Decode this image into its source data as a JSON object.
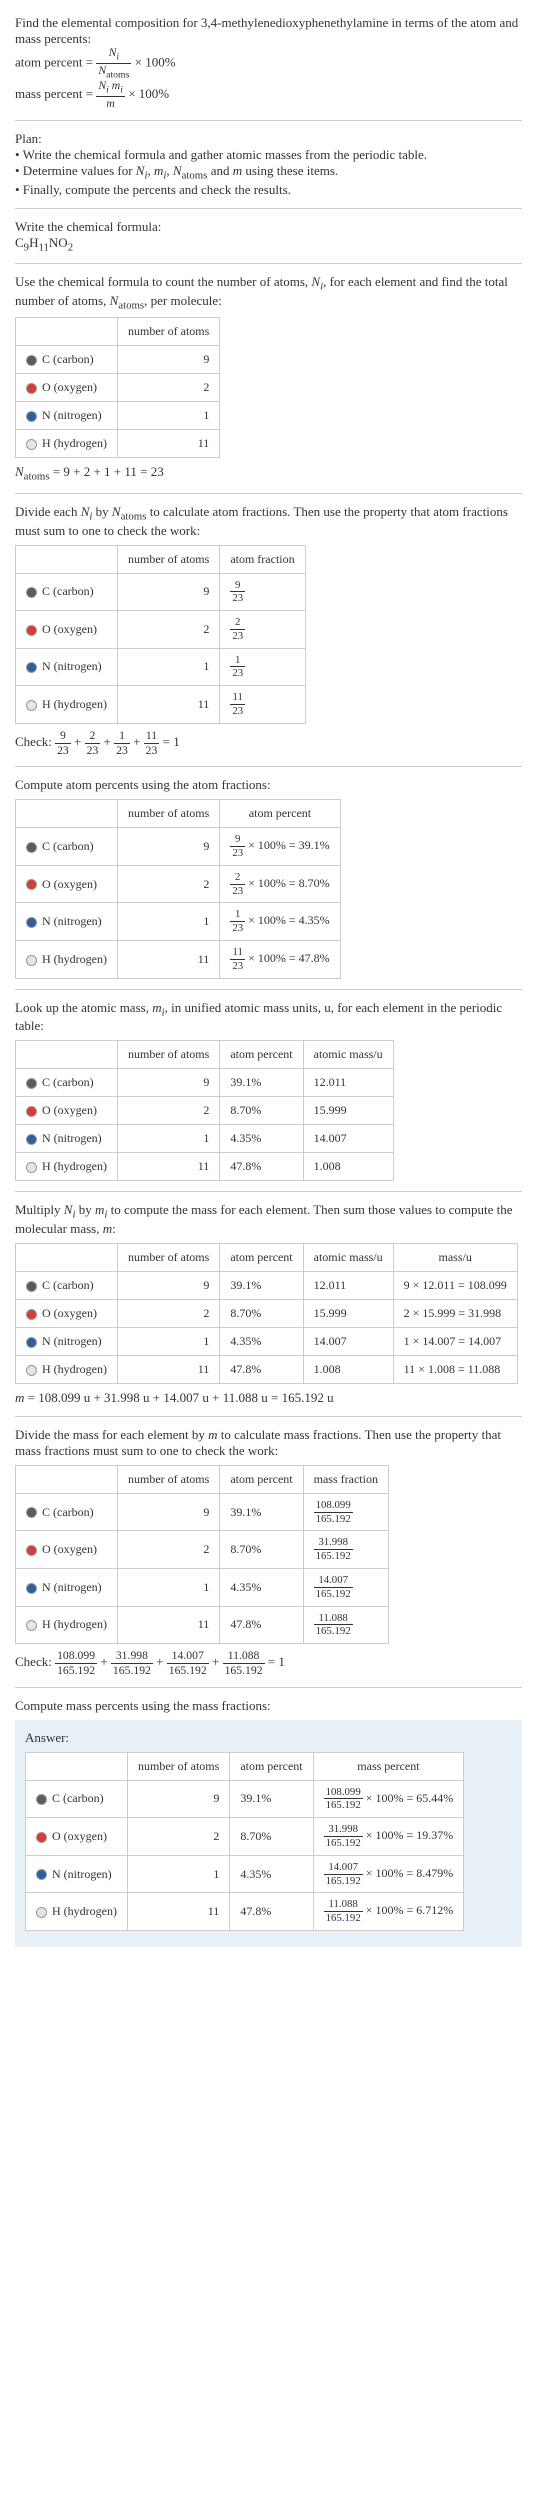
{
  "intro": {
    "title": "Find the elemental composition for 3,4-methylenedioxyphenethylamine in terms of the atom and mass percents:",
    "atom_percent_label": "atom percent =",
    "atom_percent_num": "N_i",
    "atom_percent_den": "N_atoms",
    "times100": "× 100%",
    "mass_percent_label": "mass percent =",
    "mass_percent_num": "N_i m_i",
    "mass_percent_den": "m"
  },
  "plan": {
    "heading": "Plan:",
    "b1": "• Write the chemical formula and gather atomic masses from the periodic table.",
    "b2_a": "• Determine values for ",
    "b2_b": " using these items.",
    "b3": "• Finally, compute the percents and check the results."
  },
  "plan_vars": {
    "ni": "N_i",
    "mi": "m_i",
    "na": "N_atoms",
    "m": "m",
    "and": " and "
  },
  "step_formula": {
    "label": "Write the chemical formula:",
    "formula": "C9H11NO2"
  },
  "step_count": {
    "label_a": "Use the chemical formula to count the number of atoms, ",
    "label_b": ", for each element and find the total number of atoms, ",
    "label_c": ", per molecule:",
    "h_numatoms": "number of atoms",
    "elements": [
      {
        "color": "#5b5b5b",
        "name": "C (carbon)",
        "n": "9"
      },
      {
        "color": "#d93a3a",
        "name": "O (oxygen)",
        "n": "2"
      },
      {
        "color": "#2b5fa0",
        "name": "N (nitrogen)",
        "n": "1"
      },
      {
        "color": "#e5e5e5",
        "name": "H (hydrogen)",
        "n": "11"
      }
    ],
    "total_label": "N_atoms",
    "total_eq": " = 9 + 2 + 1 + 11 = 23"
  },
  "step_atom_frac": {
    "label_a": "Divide each ",
    "label_b": " by ",
    "label_c": " to calculate atom fractions. Then use the property that atom fractions must sum to one to check the work:",
    "h_numatoms": "number of atoms",
    "h_frac": "atom fraction",
    "rows": [
      {
        "color": "#5b5b5b",
        "name": "C (carbon)",
        "n": "9",
        "num": "9",
        "den": "23"
      },
      {
        "color": "#d93a3a",
        "name": "O (oxygen)",
        "n": "2",
        "num": "2",
        "den": "23"
      },
      {
        "color": "#2b5fa0",
        "name": "N (nitrogen)",
        "n": "1",
        "num": "1",
        "den": "23"
      },
      {
        "color": "#e5e5e5",
        "name": "H (hydrogen)",
        "n": "11",
        "num": "11",
        "den": "23"
      }
    ],
    "check_label": "Check: ",
    "check_eq": " = 1"
  },
  "step_atom_pct": {
    "label": "Compute atom percents using the atom fractions:",
    "h_numatoms": "number of atoms",
    "h_pct": "atom percent",
    "rows": [
      {
        "color": "#5b5b5b",
        "name": "C (carbon)",
        "n": "9",
        "num": "9",
        "den": "23",
        "pct": " × 100% = 39.1%"
      },
      {
        "color": "#d93a3a",
        "name": "O (oxygen)",
        "n": "2",
        "num": "2",
        "den": "23",
        "pct": " × 100% = 8.70%"
      },
      {
        "color": "#2b5fa0",
        "name": "N (nitrogen)",
        "n": "1",
        "num": "1",
        "den": "23",
        "pct": " × 100% = 4.35%"
      },
      {
        "color": "#e5e5e5",
        "name": "H (hydrogen)",
        "n": "11",
        "num": "11",
        "den": "23",
        "pct": " × 100% = 47.8%"
      }
    ]
  },
  "step_mass_lookup": {
    "label_a": "Look up the atomic mass, ",
    "label_b": ", in unified atomic mass units, u, for each element in the periodic table:",
    "h_numatoms": "number of atoms",
    "h_pct": "atom percent",
    "h_mass": "atomic mass/u",
    "rows": [
      {
        "color": "#5b5b5b",
        "name": "C (carbon)",
        "n": "9",
        "pct": "39.1%",
        "mass": "12.011"
      },
      {
        "color": "#d93a3a",
        "name": "O (oxygen)",
        "n": "2",
        "pct": "8.70%",
        "mass": "15.999"
      },
      {
        "color": "#2b5fa0",
        "name": "N (nitrogen)",
        "n": "1",
        "pct": "4.35%",
        "mass": "14.007"
      },
      {
        "color": "#e5e5e5",
        "name": "H (hydrogen)",
        "n": "11",
        "pct": "47.8%",
        "mass": "1.008"
      }
    ]
  },
  "step_mass_calc": {
    "label_a": "Multiply ",
    "label_b": " by ",
    "label_c": " to compute the mass for each element. Then sum those values to compute the molecular mass, ",
    "label_d": ":",
    "h_numatoms": "number of atoms",
    "h_pct": "atom percent",
    "h_mass": "atomic mass/u",
    "h_mu": "mass/u",
    "rows": [
      {
        "color": "#5b5b5b",
        "name": "C (carbon)",
        "n": "9",
        "pct": "39.1%",
        "mass": "12.011",
        "calc": "9 × 12.011 = 108.099"
      },
      {
        "color": "#d93a3a",
        "name": "O (oxygen)",
        "n": "2",
        "pct": "8.70%",
        "mass": "15.999",
        "calc": "2 × 15.999 = 31.998"
      },
      {
        "color": "#2b5fa0",
        "name": "N (nitrogen)",
        "n": "1",
        "pct": "4.35%",
        "mass": "14.007",
        "calc": "1 × 14.007 = 14.007"
      },
      {
        "color": "#e5e5e5",
        "name": "H (hydrogen)",
        "n": "11",
        "pct": "47.8%",
        "mass": "1.008",
        "calc": "11 × 1.008 = 11.088"
      }
    ],
    "total": "m = 108.099 u + 31.998 u + 14.007 u + 11.088 u = 165.192 u"
  },
  "step_mass_frac": {
    "label_a": "Divide the mass for each element by ",
    "label_b": " to calculate mass fractions. Then use the property that mass fractions must sum to one to check the work:",
    "h_numatoms": "number of atoms",
    "h_pct": "atom percent",
    "h_frac": "mass fraction",
    "rows": [
      {
        "color": "#5b5b5b",
        "name": "C (carbon)",
        "n": "9",
        "pct": "39.1%",
        "num": "108.099",
        "den": "165.192"
      },
      {
        "color": "#d93a3a",
        "name": "O (oxygen)",
        "n": "2",
        "pct": "8.70%",
        "num": "31.998",
        "den": "165.192"
      },
      {
        "color": "#2b5fa0",
        "name": "N (nitrogen)",
        "n": "1",
        "pct": "4.35%",
        "num": "14.007",
        "den": "165.192"
      },
      {
        "color": "#e5e5e5",
        "name": "H (hydrogen)",
        "n": "11",
        "pct": "47.8%",
        "num": "11.088",
        "den": "165.192"
      }
    ],
    "check_label": "Check: ",
    "check_eq": " = 1"
  },
  "step_final": {
    "label": "Compute mass percents using the mass fractions:",
    "answer_label": "Answer:",
    "h_numatoms": "number of atoms",
    "h_pct": "atom percent",
    "h_mpct": "mass percent",
    "rows": [
      {
        "color": "#5b5b5b",
        "name": "C (carbon)",
        "n": "9",
        "pct": "39.1%",
        "num": "108.099",
        "den": "165.192",
        "res": " × 100% = 65.44%"
      },
      {
        "color": "#d93a3a",
        "name": "O (oxygen)",
        "n": "2",
        "pct": "8.70%",
        "num": "31.998",
        "den": "165.192",
        "res": " × 100% = 19.37%"
      },
      {
        "color": "#2b5fa0",
        "name": "N (nitrogen)",
        "n": "1",
        "pct": "4.35%",
        "num": "14.007",
        "den": "165.192",
        "res": " × 100% = 8.479%"
      },
      {
        "color": "#e5e5e5",
        "name": "H (hydrogen)",
        "n": "11",
        "pct": "47.8%",
        "num": "11.088",
        "den": "165.192",
        "res": " × 100% = 6.712%"
      }
    ]
  }
}
